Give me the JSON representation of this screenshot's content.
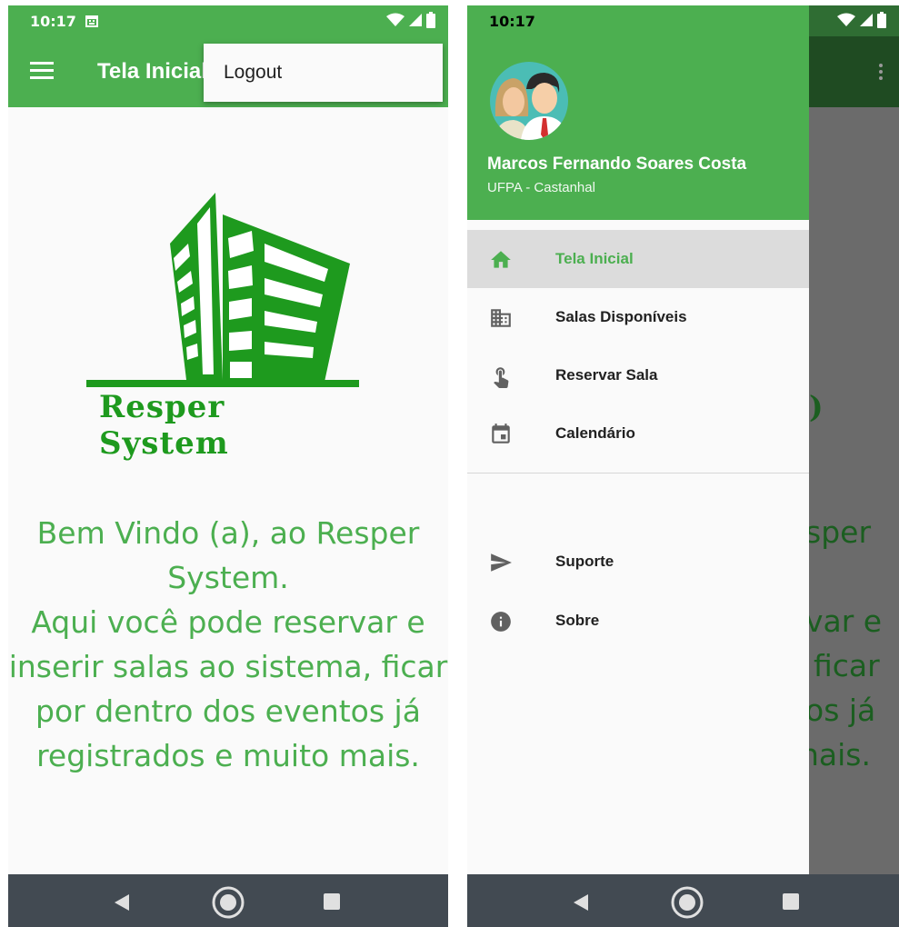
{
  "left": {
    "status": {
      "time": "10:17"
    },
    "app_bar": {
      "title": "Tela Inicial"
    },
    "overflow_menu": {
      "items": [
        {
          "label": "Logout"
        }
      ]
    },
    "logo": {
      "text": "Resper System"
    },
    "welcome_lines": [
      "Bem Vindo (a), ao Resper",
      "System.",
      "Aqui você pode reservar e",
      "inserir salas ao sistema, ficar",
      "por dentro dos eventos já",
      "registrados e muito mais."
    ]
  },
  "right": {
    "status": {
      "time": "10:17"
    },
    "drawer": {
      "user_name": "Marcos Fernando Soares Costa",
      "user_org": "UFPA - Castanhal",
      "items": [
        {
          "label": "Tela Inicial",
          "icon": "home-icon",
          "active": true
        },
        {
          "label": "Salas Disponíveis",
          "icon": "building-icon",
          "active": false
        },
        {
          "label": "Reservar Sala",
          "icon": "touch-icon",
          "active": false
        },
        {
          "label": "Calendário",
          "icon": "calendar-icon",
          "active": false
        },
        {
          "label": "Suporte",
          "icon": "send-icon",
          "active": false
        },
        {
          "label": "Sobre",
          "icon": "info-icon",
          "active": false
        }
      ]
    },
    "background_text": {
      "fragments": [
        ")",
        "sper",
        "var e",
        ", ficar",
        "os já",
        "nais."
      ]
    }
  },
  "colors": {
    "primary": "#4caf50",
    "text_dark": "#212121",
    "icon_gray": "#616161",
    "nav_bar": "#424a52"
  }
}
